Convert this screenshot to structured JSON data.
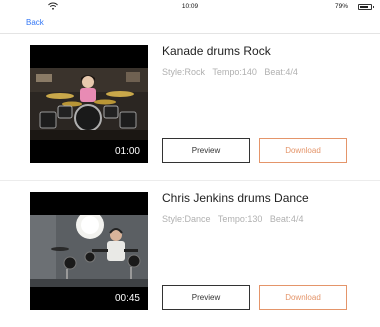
{
  "status_bar": {
    "time": "10:09",
    "battery": "79%"
  },
  "nav": {
    "back_label": "Back"
  },
  "songs": [
    {
      "title": "Kanade drums Rock",
      "style": "Style:Rock",
      "tempo": "Tempo:140",
      "beat": "Beat:4/4",
      "duration": "01:00",
      "preview_label": "Preview",
      "download_label": "Download"
    },
    {
      "title": "Chris Jenkins drums Dance",
      "style": "Style:Dance",
      "tempo": "Tempo:130",
      "beat": "Beat:4/4",
      "duration": "00:45",
      "preview_label": "Preview",
      "download_label": "Download"
    }
  ],
  "colors": {
    "back_link": "#3478f6",
    "download_accent": "#e4956a"
  }
}
